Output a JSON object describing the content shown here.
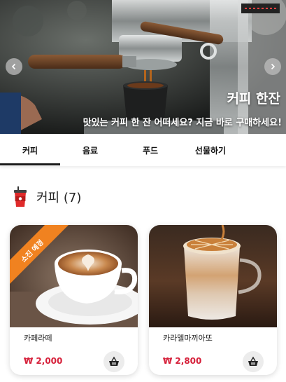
{
  "banner": {
    "title": "커피 한잔",
    "subtitle": "맛있는 커피 한 잔 어떠세요? 지금 바로 구매하세요!",
    "prev_icon": "chevron-left-icon",
    "next_icon": "chevron-right-icon"
  },
  "tabs": [
    {
      "label": "커피",
      "active": true
    },
    {
      "label": "음료",
      "active": false
    },
    {
      "label": "푸드",
      "active": false
    },
    {
      "label": "선물하기",
      "active": false
    }
  ],
  "section": {
    "title": "커피 (7)",
    "icon": "coffee-cup-icon"
  },
  "products": [
    {
      "name": "카페라떼",
      "price": "₩ 2,000",
      "badge": "소진 예정",
      "cart_icon": "basket-icon"
    },
    {
      "name": "카라멜마끼아또",
      "price": "₩ 2,800",
      "cart_icon": "basket-icon"
    }
  ],
  "colors": {
    "price": "#d6203a",
    "badge": "#f08220",
    "tab_indicator": "#1a1a1a"
  }
}
